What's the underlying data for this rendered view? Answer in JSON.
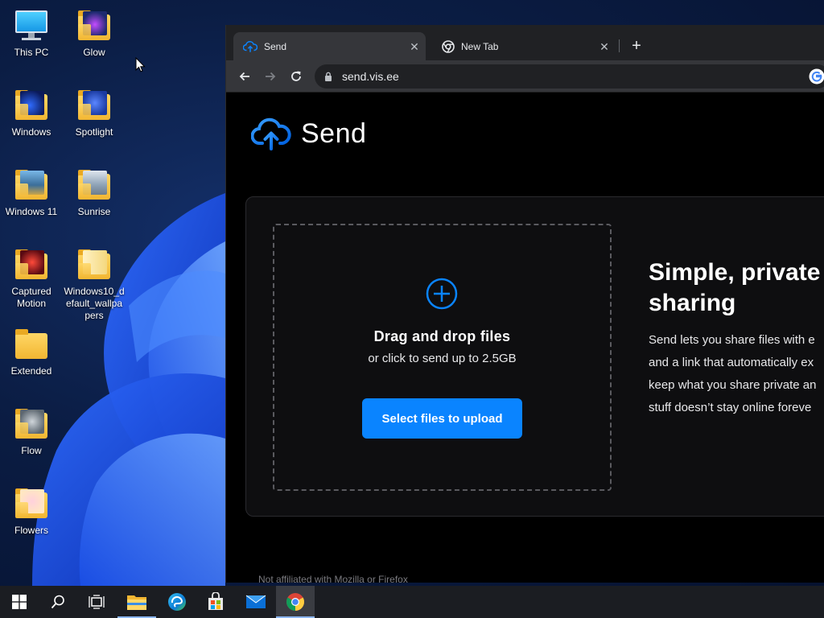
{
  "desktop": {
    "icons": [
      {
        "label": "This PC",
        "icon": "monitor-icon"
      },
      {
        "label": "Glow",
        "icon": "folder-icon"
      },
      {
        "label": "Windows",
        "icon": "folder-icon"
      },
      {
        "label": "Spotlight",
        "icon": "folder-icon"
      },
      {
        "label": "Windows 11",
        "icon": "folder-icon"
      },
      {
        "label": "Sunrise",
        "icon": "folder-icon"
      },
      {
        "label": "Captured Motion",
        "icon": "folder-icon"
      },
      {
        "label": "Windows10_default_wallpapers",
        "icon": "folder-icon"
      },
      {
        "label": "Extended",
        "icon": "folder-icon"
      },
      {
        "label": "Flow",
        "icon": "folder-icon"
      },
      {
        "label": "Flowers",
        "icon": "folder-icon"
      }
    ]
  },
  "browser": {
    "tabs": [
      {
        "title": "Send",
        "icon": "cloud-upload-icon",
        "active": true
      },
      {
        "title": "New Tab",
        "icon": "chrome-icon",
        "active": false
      }
    ],
    "new_tab_label": "+",
    "url": "send.vis.ee",
    "page": {
      "logo_text": "Send",
      "drop_title": "Drag and drop files",
      "drop_subtitle": "or click to send up to 2.5GB",
      "select_button": "Select files to upload",
      "headline": "Simple, private\nsharing",
      "description": "Send lets you share files with e\nand a link that automatically ex\nkeep what you share private an\nstuff doesn’t stay online foreve",
      "footer": "Not affiliated with Mozilla or Firefox"
    }
  },
  "colors": {
    "accent": "#0a84ff",
    "browser_dark": "#202124",
    "tab_active": "#35363a"
  },
  "taskbar": {
    "items": [
      "start-icon",
      "search-icon",
      "task-view-icon",
      "file-explorer-icon",
      "edge-icon",
      "store-icon",
      "mail-icon",
      "chrome-icon"
    ]
  }
}
